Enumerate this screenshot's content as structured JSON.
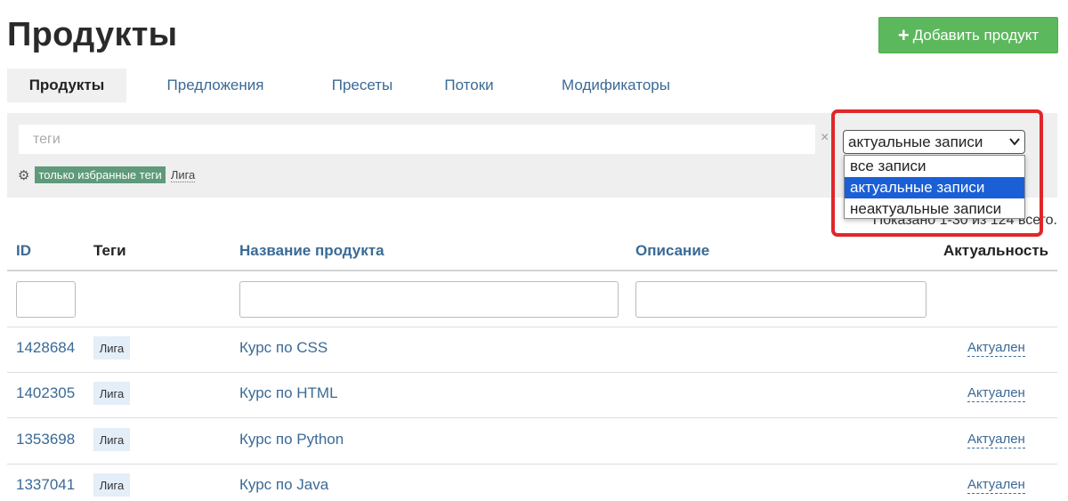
{
  "page_title": "Продукты",
  "add_button_label": "Добавить продукт",
  "tabs": [
    "Продукты",
    "Предложения",
    "Пресеты",
    "Потоки",
    "Модификаторы"
  ],
  "filter": {
    "tags_placeholder": "теги",
    "clear_glyph": "×",
    "favorites_label": "только избранные теги",
    "favorite_tag": "Лига"
  },
  "status_filter": {
    "selected": "актуальные записи",
    "options": [
      "все записи",
      "актуальные записи",
      "неактуальные записи"
    ]
  },
  "summary_text": "Показано 1-30 из 124 всего.",
  "table": {
    "columns": [
      "ID",
      "Теги",
      "Название продукта",
      "Описание",
      "Актуальность"
    ],
    "rows": [
      {
        "id": "1428684",
        "tag": "Лига",
        "name": "Курс по CSS",
        "status": "Актуален"
      },
      {
        "id": "1402305",
        "tag": "Лига",
        "name": "Курс по HTML",
        "status": "Актуален"
      },
      {
        "id": "1353698",
        "tag": "Лига",
        "name": "Курс по Python",
        "status": "Актуален"
      },
      {
        "id": "1337041",
        "tag": "Лига",
        "name": "Курс по Java",
        "status": "Актуален"
      }
    ]
  },
  "colors": {
    "primary_button": "#5cb85c",
    "link": "#3a6a96",
    "highlight": "#e0262a",
    "selected_option": "#1a5fd6",
    "favorite_badge": "#5f9a7a"
  }
}
